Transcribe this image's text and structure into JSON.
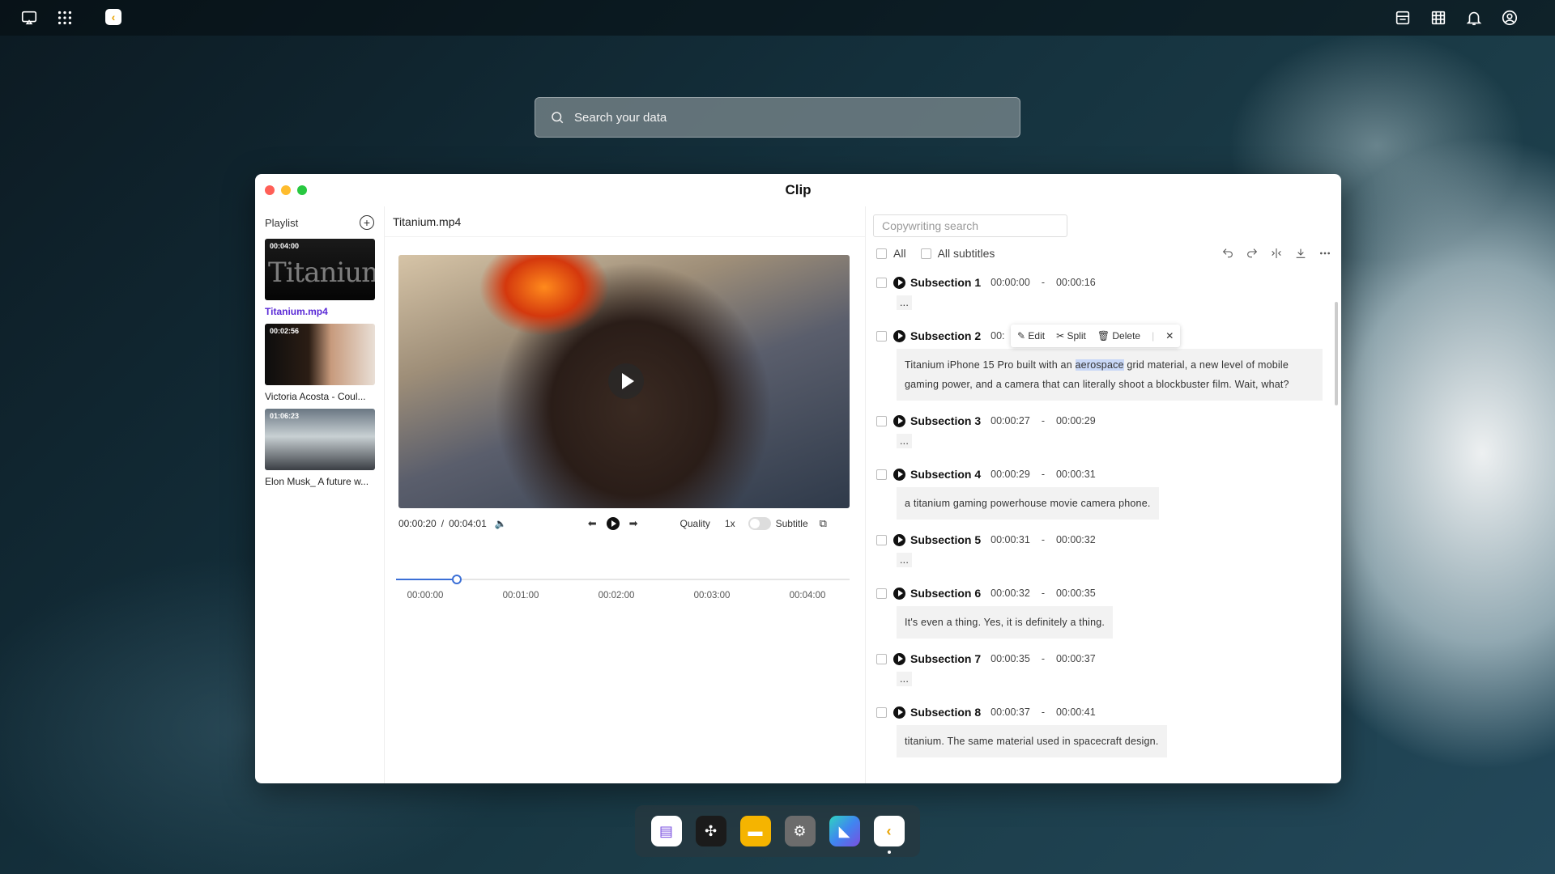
{
  "topbar": {
    "icons": [
      "screen-cast-icon",
      "app-grid-icon",
      "clip-app-icon",
      "storage-icon",
      "calendar-grid-icon",
      "bell-icon",
      "user-icon"
    ]
  },
  "search": {
    "placeholder": "Search your data"
  },
  "window": {
    "title": "Clip",
    "traffic_lights": {
      "close": "#ff5f57",
      "minimize": "#febc2e",
      "zoom": "#28c840"
    }
  },
  "playlist": {
    "label": "Playlist",
    "items": [
      {
        "name": "Titanium.mp4",
        "duration": "00:04:00",
        "thumb_text": "Titanium",
        "active": true
      },
      {
        "name": "Victoria Acosta - Coul...",
        "duration": "00:02:56",
        "active": false
      },
      {
        "name": "Elon Musk_ A future w...",
        "duration": "01:06:23",
        "active": false
      }
    ]
  },
  "player": {
    "filename": "Titanium.mp4",
    "current_time": "00:00:20",
    "separator": "/",
    "total_time": "00:04:01",
    "quality_label": "Quality",
    "speed": "1x",
    "subtitle_label": "Subtitle",
    "subtitle_on": false,
    "progress_fraction": 0.083,
    "timeline_labels": [
      "00:00:00",
      "00:01:00",
      "00:02:00",
      "00:03:00",
      "00:04:00"
    ]
  },
  "subtitles": {
    "search_placeholder": "Copywriting search",
    "filter_all": "All",
    "filter_all_subtitles": "All subtitles",
    "tool_icons": [
      "undo-icon",
      "redo-icon",
      "split-merge-icon",
      "download-icon",
      "more-icon"
    ],
    "context_menu": {
      "edit": "Edit",
      "split": "Split",
      "delete": "Delete"
    },
    "items": [
      {
        "title": "Subsection 1",
        "start": "00:00:00",
        "dash": "-",
        "end": "00:00:16",
        "text": "..."
      },
      {
        "title": "Subsection 2",
        "start": "00:",
        "dash": "",
        "end": "",
        "text_before": "Titanium iPhone 15 Pro built with an ",
        "highlight": "aerospace",
        "text_after": " grid material, a new level of mobile gaming power, and a camera that can literally shoot a blockbuster film. Wait, what?"
      },
      {
        "title": "Subsection 3",
        "start": "00:00:27",
        "dash": "-",
        "end": "00:00:29",
        "text": "..."
      },
      {
        "title": "Subsection 4",
        "start": "00:00:29",
        "dash": "-",
        "end": "00:00:31",
        "text": "a titanium gaming powerhouse movie camera phone."
      },
      {
        "title": "Subsection 5",
        "start": "00:00:31",
        "dash": "-",
        "end": "00:00:32",
        "text": "..."
      },
      {
        "title": "Subsection 6",
        "start": "00:00:32",
        "dash": "-",
        "end": "00:00:35",
        "text": "It's even a thing. Yes, it is definitely a thing."
      },
      {
        "title": "Subsection 7",
        "start": "00:00:35",
        "dash": "-",
        "end": "00:00:37",
        "text": "..."
      },
      {
        "title": "Subsection 8",
        "start": "00:00:37",
        "dash": "-",
        "end": "00:00:41",
        "text": "titanium. The same material used in spacecraft design."
      }
    ]
  },
  "dock": {
    "apps": [
      {
        "icon": "notes-app-icon",
        "color": "#7a4fe0"
      },
      {
        "icon": "network-app-icon",
        "color": "#1b1b1b"
      },
      {
        "icon": "files-app-icon",
        "color": "#f5b400"
      },
      {
        "icon": "settings-app-icon",
        "color": "#6c6c6c"
      },
      {
        "icon": "gradient-app-icon",
        "color": "#3f86f0"
      },
      {
        "icon": "clip-app-icon",
        "color": "#ffffff"
      }
    ]
  }
}
